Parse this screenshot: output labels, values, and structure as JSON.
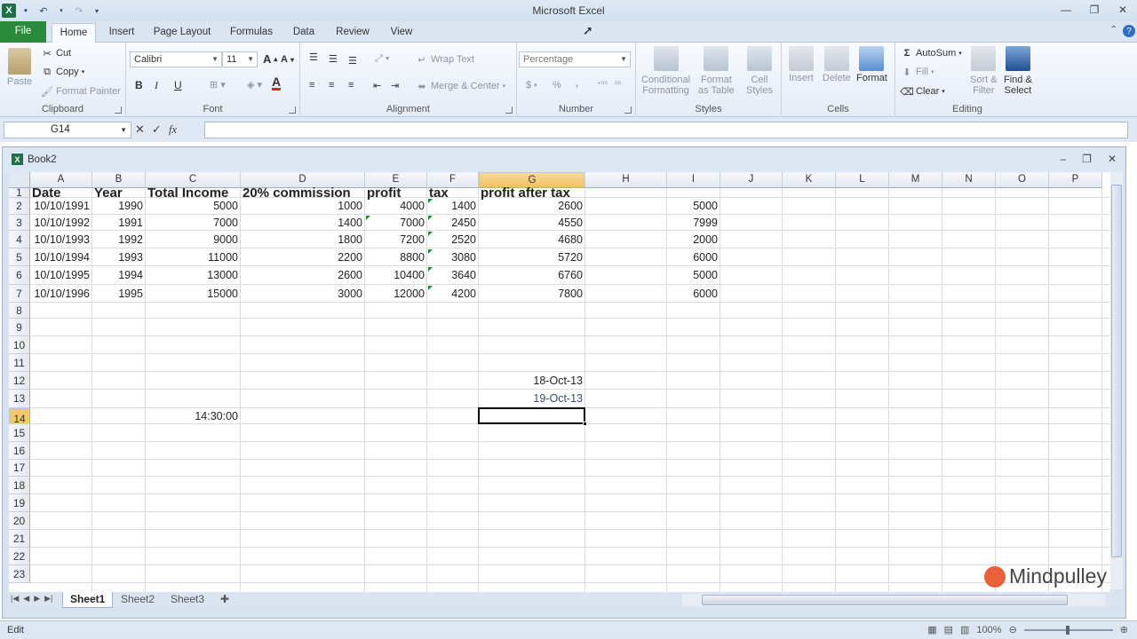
{
  "app": {
    "title": "Microsoft Excel",
    "workbook": "Book2"
  },
  "tabs": [
    "File",
    "Home",
    "Insert",
    "Page Layout",
    "Formulas",
    "Data",
    "Review",
    "View"
  ],
  "ribbon": {
    "clipboard": {
      "paste": "Paste",
      "cut": "Cut",
      "copy": "Copy",
      "format_painter": "Format Painter",
      "label": "Clipboard"
    },
    "font": {
      "name": "Calibri",
      "size": "11",
      "bold": "B",
      "italic": "I",
      "underline": "U",
      "label": "Font"
    },
    "alignment": {
      "wrap": "Wrap Text",
      "merge": "Merge & Center",
      "label": "Alignment"
    },
    "number": {
      "format": "Percentage",
      "currency": "$",
      "percent": "%",
      "comma": ",",
      "label": "Number"
    },
    "styles": {
      "conditional": "Conditional",
      "conditional2": "Formatting",
      "format_as": "Format",
      "format_as2": "as Table",
      "cell": "Cell",
      "cell2": "Styles",
      "label": "Styles"
    },
    "cells": {
      "insert": "Insert",
      "delete": "Delete",
      "format": "Format",
      "label": "Cells"
    },
    "editing": {
      "autosum": "AutoSum",
      "fill": "Fill",
      "clear": "Clear",
      "sort": "Sort &",
      "sort2": "Filter",
      "find": "Find &",
      "find2": "Select",
      "label": "Editing"
    }
  },
  "formula_bar": {
    "name_box": "G14",
    "cancel": "✕",
    "enter": "✓",
    "fx": "fx",
    "content": ""
  },
  "columns": [
    "A",
    "B",
    "C",
    "D",
    "E",
    "F",
    "G",
    "H",
    "I",
    "J",
    "K",
    "L",
    "M",
    "N",
    "O",
    "P"
  ],
  "rows": [
    "1",
    "2",
    "3",
    "4",
    "5",
    "6",
    "7",
    "8",
    "9",
    "10",
    "11",
    "12",
    "13",
    "14",
    "15",
    "16",
    "17",
    "18",
    "19",
    "20",
    "21",
    "22",
    "23"
  ],
  "cells": {
    "A1": "Date",
    "B1": "Year",
    "C1": "Total Income",
    "D1": "20% commission",
    "E1": "profit",
    "F1": "tax",
    "G1": "profit after tax",
    "A2": "10/10/1991",
    "B2": "1990",
    "C2": "5000",
    "D2": "1000",
    "E2": "4000",
    "F2": "1400",
    "G2": "2600",
    "I2": "5000",
    "A3": "10/10/1992",
    "B3": "1991",
    "C3": "7000",
    "D3": "1400",
    "E3": "7000",
    "F3": "2450",
    "G3": "4550",
    "I3": "7999",
    "A4": "10/10/1993",
    "B4": "1992",
    "C4": "9000",
    "D4": "1800",
    "E4": "7200",
    "F4": "2520",
    "G4": "4680",
    "I4": "2000",
    "A5": "10/10/1994",
    "B5": "1993",
    "C5": "11000",
    "D5": "2200",
    "E5": "8800",
    "F5": "3080",
    "G5": "5720",
    "I5": "6000",
    "A6": "10/10/1995",
    "B6": "1994",
    "C6": "13000",
    "D6": "2600",
    "E6": "10400",
    "F6": "3640",
    "G6": "6760",
    "I6": "5000",
    "A7": "10/10/1996",
    "B7": "1995",
    "C7": "15000",
    "D7": "3000",
    "E7": "12000",
    "F7": "4200",
    "G7": "7800",
    "I7": "6000",
    "G12": "18-Oct-13",
    "G13": "19-Oct-13",
    "C14": "14:30:00"
  },
  "active_cell": "G14",
  "sheets": [
    "Sheet1",
    "Sheet2",
    "Sheet3"
  ],
  "status": {
    "mode": "Edit",
    "zoom": "100%"
  },
  "watermark": "Mindpulley"
}
